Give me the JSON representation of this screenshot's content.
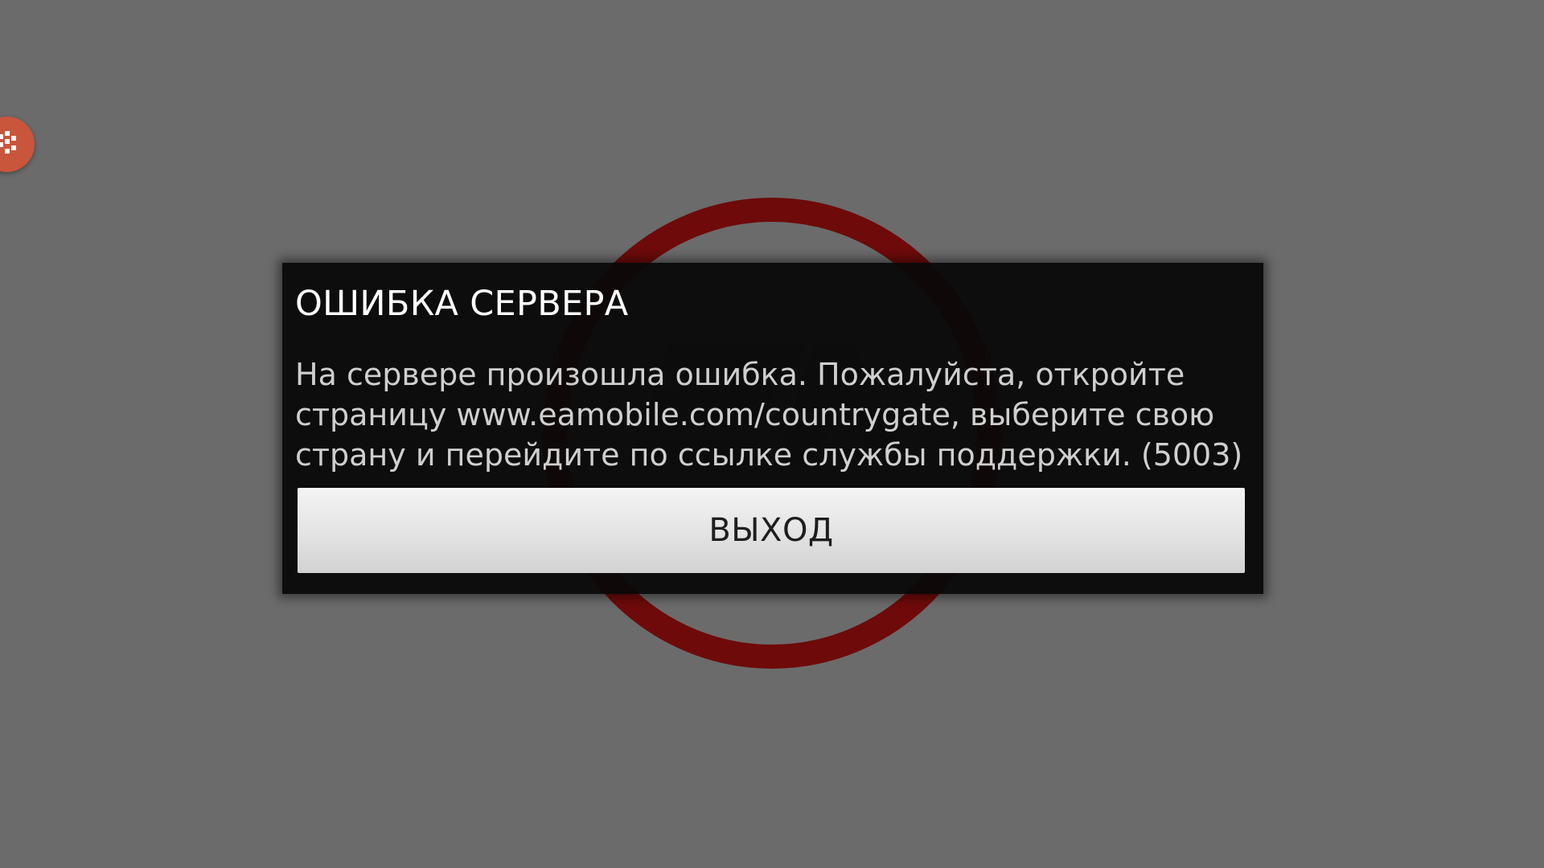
{
  "background": {
    "color": "#6b6b6b",
    "logo_icon": "ea-logo-icon",
    "logo_color": "#6e0a0a"
  },
  "floating_widget": {
    "icon": "dots-icon",
    "color": "#c9553b"
  },
  "dialog": {
    "title": "ОШИБКА СЕРВЕРА",
    "message": "На сервере произошла ошибка. Пожалуйста, откройте страницу www.eamobile.com/countrygate, выберите свою страну и перейдите по ссылке службы поддержки. (5003)",
    "exit_label": "ВЫХОД"
  }
}
